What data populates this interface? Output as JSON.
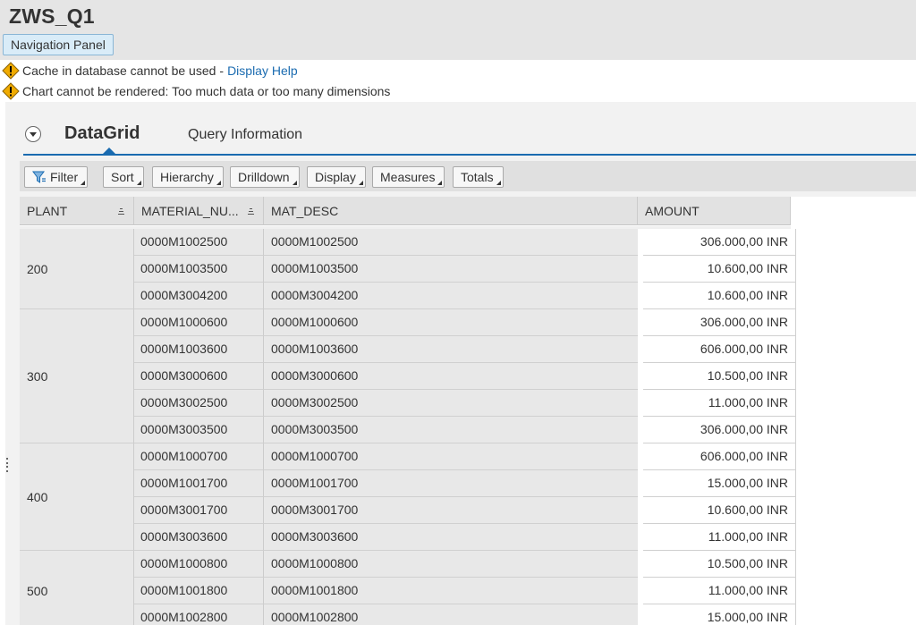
{
  "app": {
    "title": "ZWS_Q1",
    "nav_panel_label": "Navigation Panel"
  },
  "messages": [
    {
      "text": "Cache in database cannot be used",
      "separator": "-",
      "link": "Display Help"
    },
    {
      "text": "Chart cannot be rendered: Too much data or too many dimensions"
    }
  ],
  "tabs": {
    "active": "DataGrid",
    "inactive": "Query Information"
  },
  "toolbar": {
    "filter": "Filter",
    "sort": "Sort",
    "hierarchy": "Hierarchy",
    "drilldown": "Drilldown",
    "display": "Display",
    "measures": "Measures",
    "totals": "Totals"
  },
  "grid": {
    "headers": {
      "plant": "PLANT",
      "material_number": "MATERIAL_NU...",
      "mat_desc": "MAT_DESC",
      "amount": "AMOUNT"
    },
    "groups": [
      {
        "plant": "200",
        "rows": [
          {
            "mat": "0000M1002500",
            "desc": "0000M1002500",
            "amount": "306.000,00 INR"
          },
          {
            "mat": "0000M1003500",
            "desc": "0000M1003500",
            "amount": "10.600,00 INR"
          },
          {
            "mat": "0000M3004200",
            "desc": "0000M3004200",
            "amount": "10.600,00 INR"
          }
        ]
      },
      {
        "plant": "300",
        "rows": [
          {
            "mat": "0000M1000600",
            "desc": "0000M1000600",
            "amount": "306.000,00 INR"
          },
          {
            "mat": "0000M1003600",
            "desc": "0000M1003600",
            "amount": "606.000,00 INR"
          },
          {
            "mat": "0000M3000600",
            "desc": "0000M3000600",
            "amount": "10.500,00 INR"
          },
          {
            "mat": "0000M3002500",
            "desc": "0000M3002500",
            "amount": "11.000,00 INR"
          },
          {
            "mat": "0000M3003500",
            "desc": "0000M3003500",
            "amount": "306.000,00 INR"
          }
        ]
      },
      {
        "plant": "400",
        "rows": [
          {
            "mat": "0000M1000700",
            "desc": "0000M1000700",
            "amount": "606.000,00 INR"
          },
          {
            "mat": "0000M1001700",
            "desc": "0000M1001700",
            "amount": "15.000,00 INR"
          },
          {
            "mat": "0000M3001700",
            "desc": "0000M3001700",
            "amount": "10.600,00 INR"
          },
          {
            "mat": "0000M3003600",
            "desc": "0000M3003600",
            "amount": "11.000,00 INR"
          }
        ]
      },
      {
        "plant": "500",
        "rows": [
          {
            "mat": "0000M1000800",
            "desc": "0000M1000800",
            "amount": "10.500,00 INR"
          },
          {
            "mat": "0000M1001800",
            "desc": "0000M1001800",
            "amount": "11.000,00 INR"
          },
          {
            "mat": "0000M1002800",
            "desc": "0000M1002800",
            "amount": "15.000,00 INR"
          }
        ]
      }
    ]
  },
  "colors": {
    "accent": "#1a6bb0",
    "warning": "#f0ab00"
  }
}
